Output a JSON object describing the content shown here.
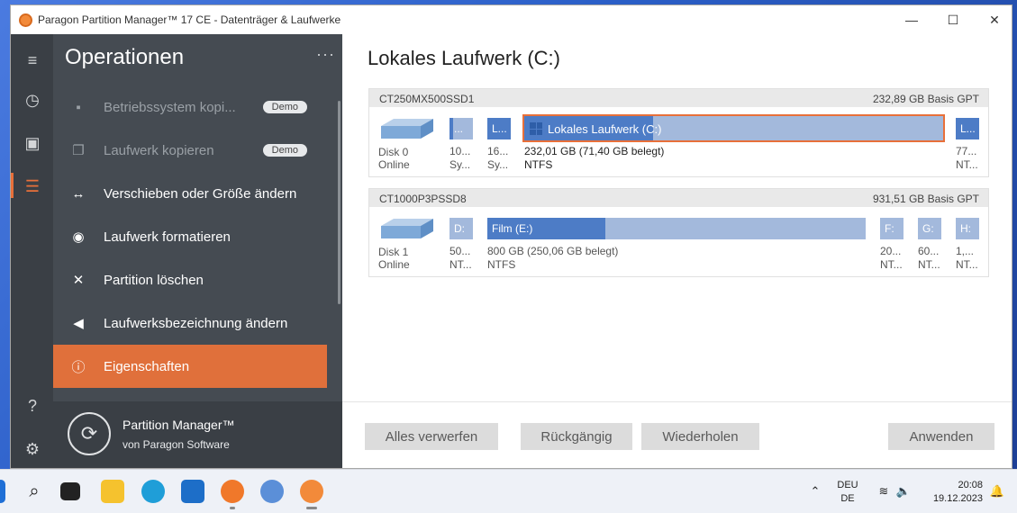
{
  "window": {
    "title": "Paragon Partition Manager™ 17 CE - Datenträger & Laufwerke"
  },
  "ops": {
    "title": "Operationen",
    "more": "···",
    "items": [
      {
        "label": "Betriebssystem  kopi...",
        "badge": "Demo"
      },
      {
        "label": "Laufwerk kopieren",
        "badge": "Demo"
      },
      {
        "label": "Verschieben oder Größe ändern"
      },
      {
        "label": "Laufwerk formatieren"
      },
      {
        "label": "Partition löschen"
      },
      {
        "label": "Laufwerksbezeichnung ändern"
      },
      {
        "label": "Eigenschaften"
      }
    ]
  },
  "brand": {
    "name": "Partition Manager™",
    "by": "von Paragon Software"
  },
  "main": {
    "title": "Lokales Laufwerk (C:)"
  },
  "disks": [
    {
      "name": "CT250MX500SSD1",
      "info": "232,89 GB Basis GPT",
      "id": "Disk 0",
      "status": "Online",
      "parts": [
        {
          "label": "...",
          "size": "10...",
          "fs": "Sy...",
          "used": 0.0
        },
        {
          "label": "L...",
          "size": "16...",
          "fs": "Sy...",
          "used": 1.0
        },
        {
          "label": "Lokales Laufwerk (C:)",
          "size": "232,01 GB (71,40 GB belegt)",
          "fs": "NTFS",
          "used": 0.31
        },
        {
          "label": "L...",
          "size": "77...",
          "fs": "NT...",
          "used": 1.0
        }
      ]
    },
    {
      "name": "CT1000P3PSSD8",
      "info": "931,51 GB Basis GPT",
      "id": "Disk 1",
      "status": "Online",
      "parts": [
        {
          "label": "D:",
          "size": "50...",
          "fs": "NT...",
          "used": 0.0
        },
        {
          "label": "Film (E:)",
          "size": "800 GB (250,06 GB belegt)",
          "fs": "NTFS",
          "used": 0.31
        },
        {
          "label": "F:",
          "size": "20...",
          "fs": "NT...",
          "used": 0.0
        },
        {
          "label": "G:",
          "size": "60...",
          "fs": "NT...",
          "used": 0.0
        },
        {
          "label": "H:",
          "size": "1,...",
          "fs": "NT...",
          "used": 0.0
        }
      ]
    }
  ],
  "buttons": {
    "discard": "Alles verwerfen",
    "undo": "Rückgängig",
    "redo": "Wiederholen",
    "apply": "Anwenden"
  },
  "tray": {
    "lang1": "DEU",
    "lang2": "DE",
    "time": "20:08",
    "date": "19.12.2023"
  }
}
